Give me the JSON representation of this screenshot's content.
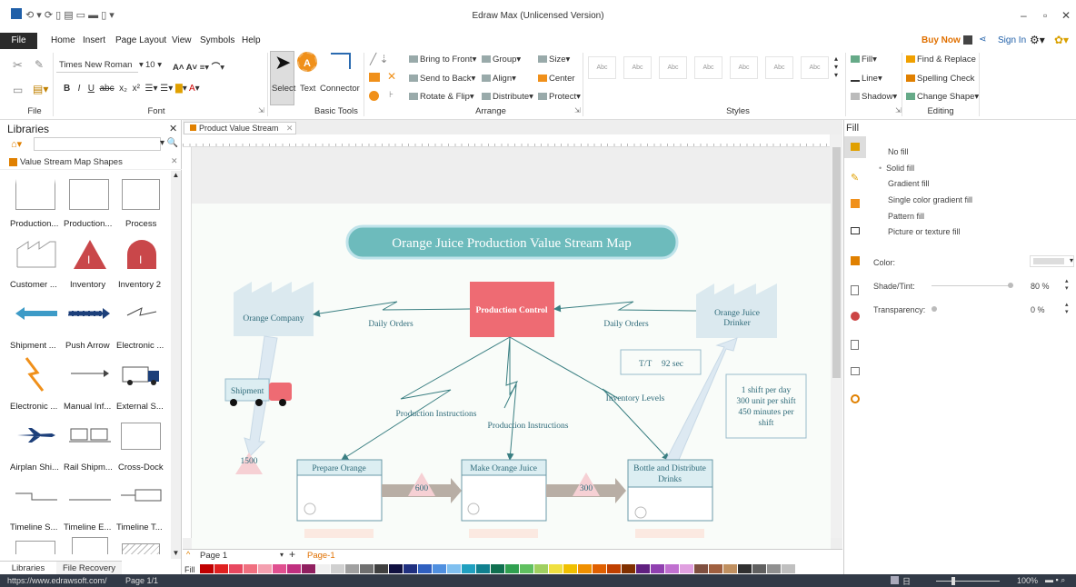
{
  "app": {
    "title": "Edraw Max (Unlicensed Version)"
  },
  "menu": {
    "file": "File",
    "items": [
      "Home",
      "Insert",
      "Page Layout",
      "View",
      "Symbols",
      "Help"
    ],
    "buy_now": "Buy Now",
    "sign_in": "Sign In"
  },
  "ribbon": {
    "font_name": "Times New Roman",
    "font_size": "10",
    "select": "Select",
    "text": "Text",
    "connector": "Connector",
    "bring_to_front": "Bring to Front",
    "send_to_back": "Send to Back",
    "rotate_flip": "Rotate & Flip",
    "group": "Group",
    "align": "Align",
    "distribute": "Distribute",
    "size": "Size",
    "center": "Center",
    "protect": "Protect",
    "fill": "Fill",
    "line": "Line",
    "shadow": "Shadow",
    "find_replace": "Find & Replace",
    "spelling": "Spelling Check",
    "change_shape": "Change Shape",
    "style_sample": "Abc",
    "groups": {
      "file": "File",
      "font": "Font",
      "basic_tools": "Basic Tools",
      "arrange": "Arrange",
      "styles": "Styles",
      "editing": "Editing"
    }
  },
  "libraries": {
    "title": "Libraries",
    "category": "Value Stream Map Shapes",
    "shapes": [
      "Production...",
      "Production...",
      "Process",
      "Customer ...",
      "Inventory",
      "Inventory 2",
      "Shipment ...",
      "Push Arrow",
      "Electronic ...",
      "Electronic ...",
      "Manual Inf...",
      "External S...",
      "Airplan Shi...",
      "Rail Shipm...",
      "Cross-Dock",
      "Timeline S...",
      "Timeline E...",
      "Timeline T..."
    ],
    "tabs": [
      "Libraries",
      "File Recovery"
    ]
  },
  "document": {
    "tab": "Product Value Stream"
  },
  "diagram": {
    "title": "Orange Juice Production Value Stream Map",
    "supplier": "Orange Company",
    "customer_line1": "Orange Juice",
    "customer_line2": "Drinker",
    "control": "Production Control",
    "daily_orders_left": "Daily Orders",
    "daily_orders_right": "Daily Orders",
    "tt": "T/T",
    "tt_val": "92 sec",
    "info_lines": [
      "1 shift per day",
      "300 unit per shift",
      "450 minutes per",
      "shift"
    ],
    "shipment": "Shipment",
    "inv_supplier": "1500",
    "prod_instr_1": "Production Instructions",
    "prod_instr_2": "Production Instructions",
    "inventory_levels": "Inventory Levels",
    "process_1": "Prepare Orange",
    "process_2": "Make Orange Juice",
    "process_3_line1": "Bottle and Distribute",
    "process_3_line2": "Drinks",
    "inv_1": "600",
    "inv_2": "300"
  },
  "right_panel": {
    "title": "Fill",
    "options": [
      "No fill",
      "Solid fill",
      "Gradient fill",
      "Single color gradient fill",
      "Pattern fill",
      "Picture or texture fill"
    ],
    "color_label": "Color:",
    "shade_label": "Shade/Tint:",
    "shade_val": "80 %",
    "transparency_label": "Transparency:",
    "transparency_val": "0 %"
  },
  "pagebar": {
    "page_tab": "Page 1",
    "page_active": "Page-1",
    "fill_label": "Fill"
  },
  "status": {
    "url": "https://www.edrawsoft.com/",
    "page": "Page 1/1",
    "zoom": "100%"
  }
}
